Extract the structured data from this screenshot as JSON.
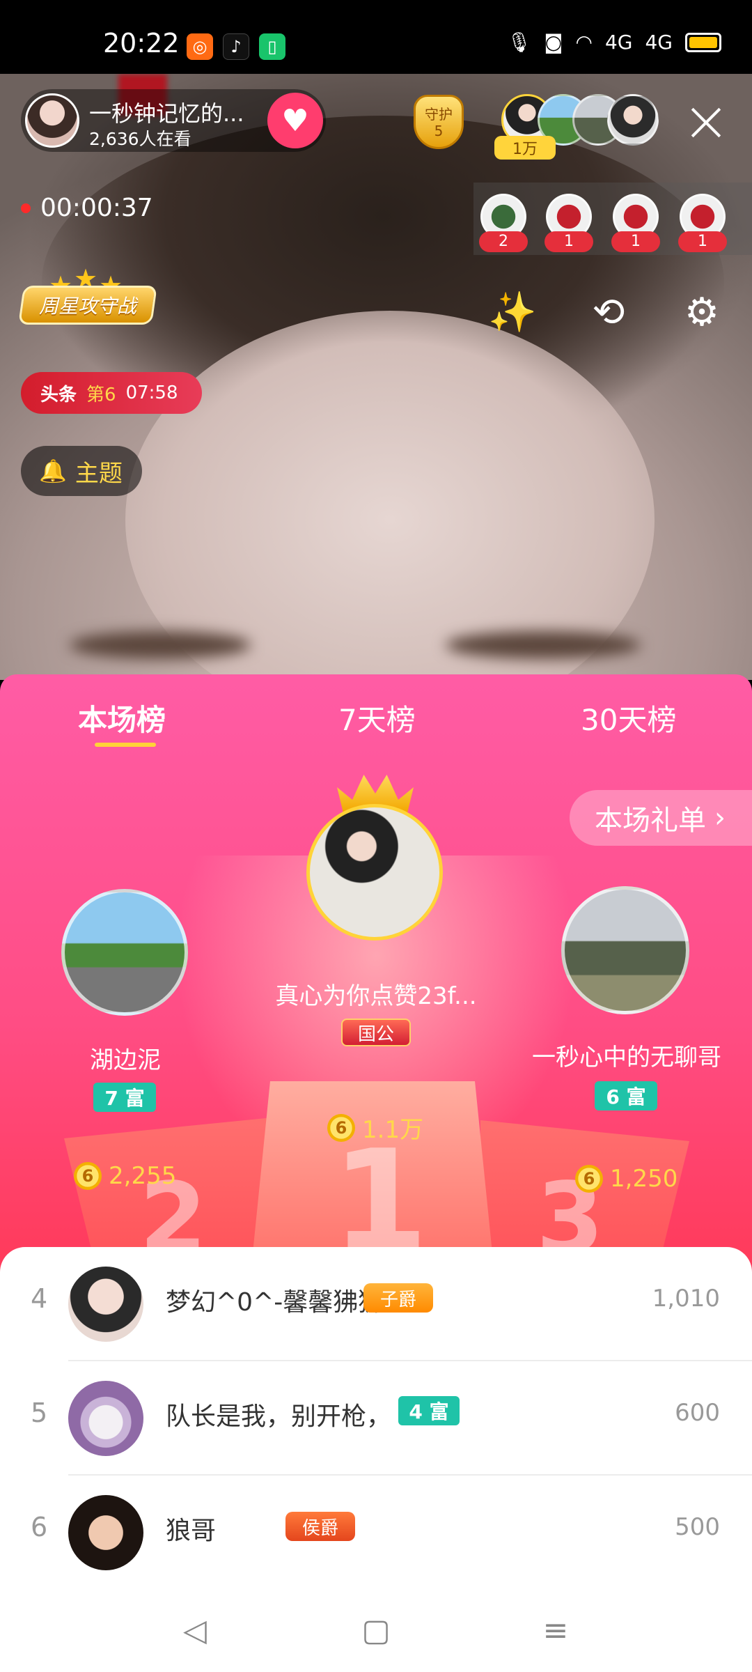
{
  "status_bar": {
    "time": "20:22",
    "network": "4G",
    "network2": "4G"
  },
  "live": {
    "host_name": "一秒钟记忆的...",
    "viewers": "2,636人在看",
    "guard_label": "守护",
    "guard_count": "5",
    "fan_badge": "1万",
    "duration": "00:00:37",
    "gifter_counts": [
      "2",
      "1",
      "1",
      "1"
    ],
    "weekstar": "周星攻守战",
    "headline": {
      "tag": "头条",
      "rank": "第6",
      "time": "07:58"
    },
    "topic": "主题"
  },
  "ranking": {
    "tabs": [
      "本场榜",
      "7天榜",
      "30天榜"
    ],
    "active_tab": 0,
    "gift_list_button": "本场礼单",
    "top3": [
      {
        "rank": "1",
        "name": "真心为你点赞23f...",
        "badge": "国公",
        "coins": "1.1万"
      },
      {
        "rank": "2",
        "name": "湖边泥",
        "badge": "7 富",
        "coins": "2,255"
      },
      {
        "rank": "3",
        "name": "一秒心中的无聊哥",
        "badge": "6 富",
        "coins": "1,250"
      }
    ],
    "list": [
      {
        "rank": "4",
        "name": "梦幻^0^-馨馨狒狒",
        "badge": "子爵",
        "score": "1,010"
      },
      {
        "rank": "5",
        "name": "队长是我，别开枪，",
        "badge": "4 富",
        "score": "600"
      },
      {
        "rank": "6",
        "name": "狼哥",
        "badge": "侯爵",
        "score": "500"
      }
    ]
  },
  "colors": {
    "accent_pink": "#ff4d84",
    "gold": "#ffd84a",
    "rich_green": "#1fc3a8"
  }
}
